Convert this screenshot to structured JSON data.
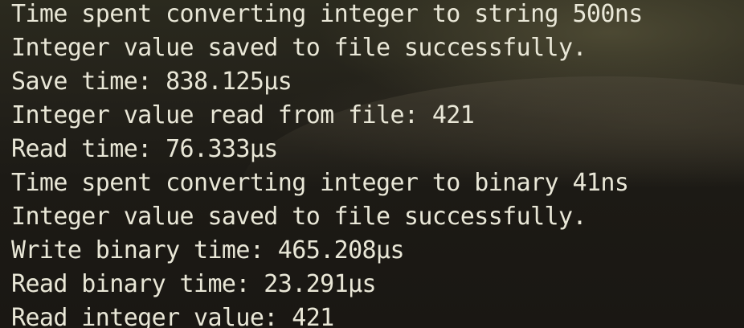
{
  "terminal": {
    "lines": [
      "Time spent converting integer to string 500ns",
      "Integer value saved to file successfully.",
      "Save time: 838.125µs",
      "Integer value read from file: 421",
      "Read time: 76.333µs",
      "Time spent converting integer to binary 41ns",
      "Integer value saved to file successfully.",
      "Write binary time: 465.208µs",
      "Read binary time: 23.291µs",
      "Read integer value: 421"
    ]
  },
  "colors": {
    "text": "#e9e7d7",
    "background": "#1c1a15"
  }
}
